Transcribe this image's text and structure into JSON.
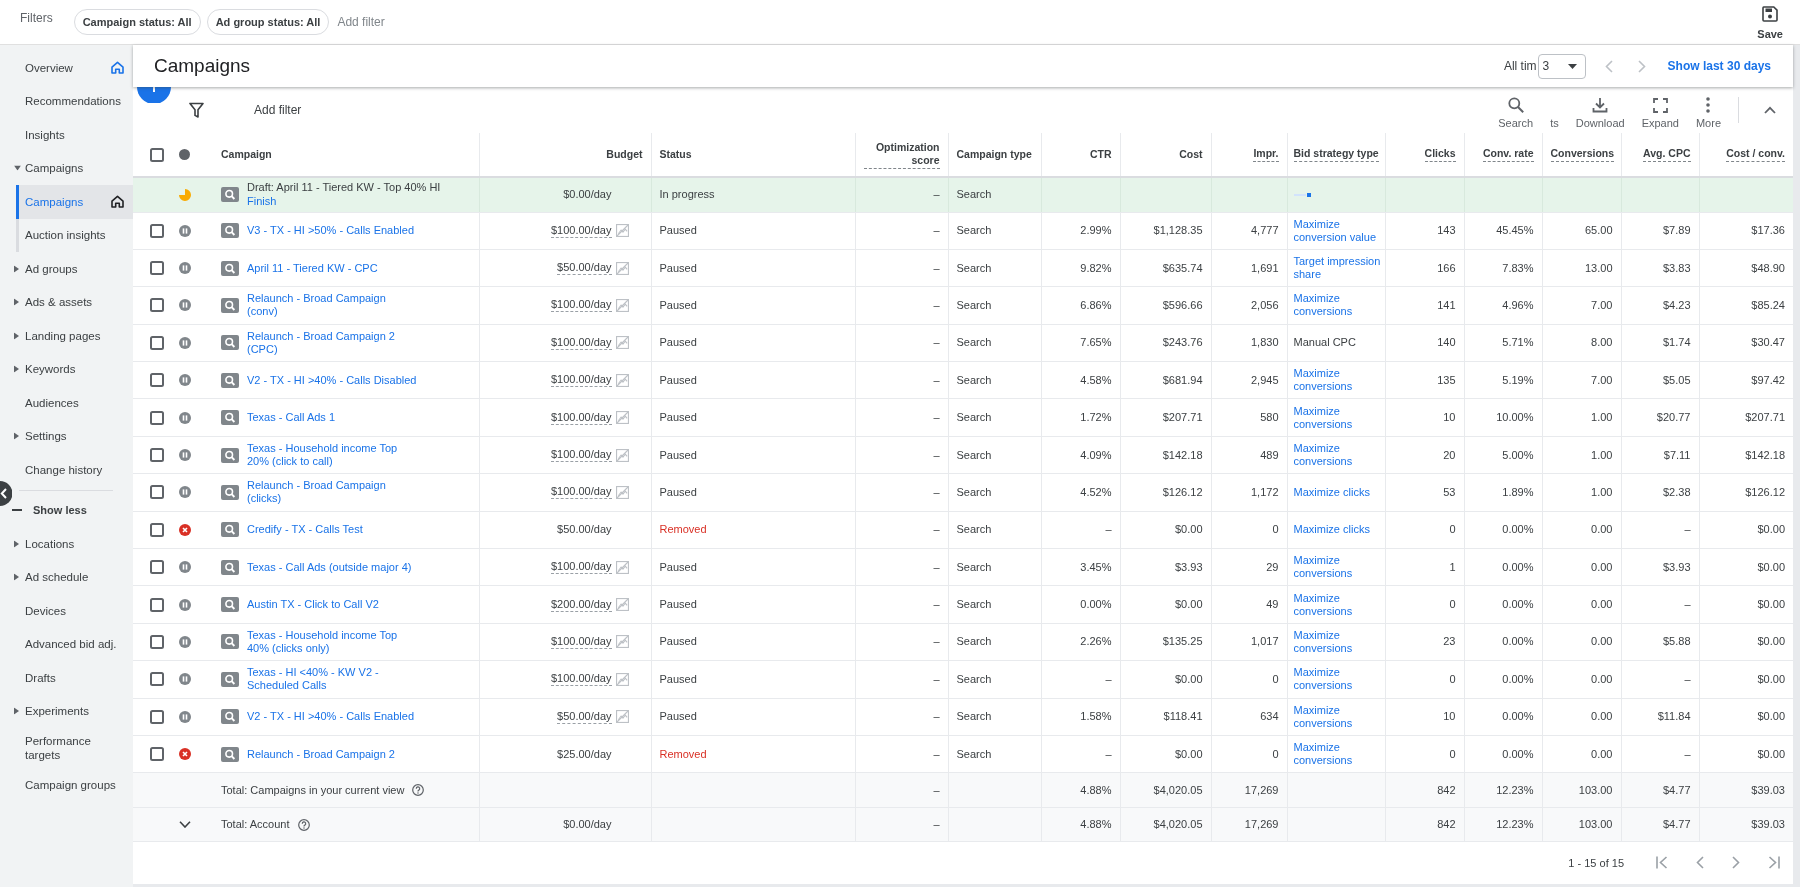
{
  "filter_bar": {
    "label": "Filters",
    "chips": [
      "Campaign status: All",
      "Ad group status: All"
    ],
    "add_filter": "Add filter",
    "save": "Save"
  },
  "sidebar": {
    "items": [
      {
        "label": "Overview",
        "selected": false,
        "home": true
      },
      {
        "label": "Recommendations",
        "selected": false
      },
      {
        "label": "Insights",
        "selected": false
      },
      {
        "label": "Campaigns",
        "selected": false,
        "expanded": true,
        "children": [
          {
            "label": "Campaigns",
            "selected": true,
            "home": false
          },
          {
            "label": "Auction insights",
            "selected": false
          }
        ]
      },
      {
        "label": "Ad groups",
        "selected": false,
        "expanded": false
      },
      {
        "label": "Ads & assets",
        "selected": false,
        "expanded": false
      },
      {
        "label": "Landing pages",
        "selected": false,
        "expanded": false
      },
      {
        "label": "Keywords",
        "selected": false,
        "expanded": false
      },
      {
        "label": "Audiences",
        "selected": false
      },
      {
        "label": "Settings",
        "selected": false,
        "expanded": false
      },
      {
        "label": "Change history",
        "selected": false
      }
    ],
    "toggle": "Show less",
    "more_items": [
      {
        "label": "Locations",
        "selected": false,
        "expanded": false
      },
      {
        "label": "Ad schedule",
        "selected": false,
        "expanded": false
      },
      {
        "label": "Devices",
        "selected": false
      },
      {
        "label": "Advanced bid adj.",
        "selected": false
      },
      {
        "label": "Drafts",
        "selected": false
      },
      {
        "label": "Experiments",
        "selected": false,
        "expanded": false
      },
      {
        "label": "Performance targets",
        "selected": false
      },
      {
        "label": "Campaign groups",
        "selected": false
      }
    ]
  },
  "page_header": {
    "title": "Campaigns",
    "date_label": "All tim",
    "date_value": "3",
    "date_link": "Show last 30 days"
  },
  "toolbar": {
    "add_filter": "Add filter",
    "buttons": [
      {
        "kind": "search",
        "label": "Search"
      },
      {
        "kind": "text",
        "label": "ts"
      },
      {
        "kind": "download",
        "label": "Download"
      },
      {
        "kind": "expand",
        "label": "Expand"
      },
      {
        "kind": "more",
        "label": "More"
      }
    ]
  },
  "table": {
    "select_all": {
      "checked": false
    },
    "columns": [
      {
        "label": "Campaign",
        "kind": "text",
        "dashed": false
      },
      {
        "label": "Budget",
        "kind": "number",
        "dashed": false
      },
      {
        "label": "Status",
        "kind": "text",
        "dashed": false
      },
      {
        "label": "Optimization score",
        "kind": "number",
        "dashed": true
      },
      {
        "label": "Campaign type",
        "kind": "text",
        "dashed": false
      },
      {
        "label": "CTR",
        "kind": "number",
        "dashed": false
      },
      {
        "label": "Cost",
        "kind": "number",
        "dashed": false
      },
      {
        "label": "Impr.",
        "kind": "number",
        "dashed": true
      },
      {
        "label": "Bid strategy type",
        "kind": "text",
        "dashed": true
      },
      {
        "label": "Clicks",
        "kind": "number",
        "dashed": true
      },
      {
        "label": "Conv. rate",
        "kind": "number",
        "dashed": true
      },
      {
        "label": "Conversions",
        "kind": "number",
        "dashed": true
      },
      {
        "label": "Avg. CPC",
        "kind": "number",
        "dashed": true
      },
      {
        "label": "Cost / conv.",
        "kind": "number",
        "dashed": true
      }
    ],
    "rows": [
      {
        "kind": "draft",
        "action": "Finish",
        "budget_icon": false,
        "cells": [
          "Draft: April 11 - Tiered KW - Top 40% HI",
          "$0.00/day",
          "In progress",
          "–",
          "Search",
          "",
          "",
          "",
          "",
          "",
          "",
          "",
          "",
          ""
        ]
      },
      {
        "kind": "paused",
        "checked": false,
        "budget_icon": true,
        "bid_link": true,
        "cells": [
          "V3 - TX - HI >50% - Calls Enabled",
          "$100.00/day",
          "Paused",
          "–",
          "Search",
          "2.99%",
          "$1,128.35",
          "4,777",
          "Maximize conversion value",
          "143",
          "45.45%",
          "65.00",
          "$7.89",
          "$17.36"
        ]
      },
      {
        "kind": "paused",
        "checked": false,
        "budget_icon": true,
        "bid_link": true,
        "cells": [
          "April 11 - Tiered KW - CPC",
          "$50.00/day",
          "Paused",
          "–",
          "Search",
          "9.82%",
          "$635.74",
          "1,691",
          "Target impression share",
          "166",
          "7.83%",
          "13.00",
          "$3.83",
          "$48.90"
        ]
      },
      {
        "kind": "paused",
        "checked": false,
        "budget_icon": true,
        "bid_link": true,
        "cells": [
          "Relaunch - Broad Campaign (conv)",
          "$100.00/day",
          "Paused",
          "–",
          "Search",
          "6.86%",
          "$596.66",
          "2,056",
          "Maximize conversions",
          "141",
          "4.96%",
          "7.00",
          "$4.23",
          "$85.24"
        ]
      },
      {
        "kind": "paused",
        "checked": false,
        "budget_icon": true,
        "bid_link": false,
        "cells": [
          "Relaunch - Broad Campaign 2 (CPC)",
          "$100.00/day",
          "Paused",
          "–",
          "Search",
          "7.65%",
          "$243.76",
          "1,830",
          "Manual CPC",
          "140",
          "5.71%",
          "8.00",
          "$1.74",
          "$30.47"
        ]
      },
      {
        "kind": "paused",
        "checked": false,
        "budget_icon": true,
        "bid_link": true,
        "cells": [
          "V2 - TX - HI >40% - Calls Disabled",
          "$100.00/day",
          "Paused",
          "–",
          "Search",
          "4.58%",
          "$681.94",
          "2,945",
          "Maximize conversions",
          "135",
          "5.19%",
          "7.00",
          "$5.05",
          "$97.42"
        ]
      },
      {
        "kind": "paused",
        "checked": false,
        "budget_icon": true,
        "bid_link": true,
        "cells": [
          "Texas - Call Ads 1",
          "$100.00/day",
          "Paused",
          "–",
          "Search",
          "1.72%",
          "$207.71",
          "580",
          "Maximize conversions",
          "10",
          "10.00%",
          "1.00",
          "$20.77",
          "$207.71"
        ]
      },
      {
        "kind": "paused",
        "checked": false,
        "budget_icon": true,
        "bid_link": true,
        "cells": [
          "Texas - Household income Top 20% (click to call)",
          "$100.00/day",
          "Paused",
          "–",
          "Search",
          "4.09%",
          "$142.18",
          "489",
          "Maximize conversions",
          "20",
          "5.00%",
          "1.00",
          "$7.11",
          "$142.18"
        ]
      },
      {
        "kind": "paused",
        "checked": false,
        "budget_icon": true,
        "bid_link": true,
        "cells": [
          "Relaunch - Broad Campaign (clicks)",
          "$100.00/day",
          "Paused",
          "–",
          "Search",
          "4.52%",
          "$126.12",
          "1,172",
          "Maximize clicks",
          "53",
          "1.89%",
          "1.00",
          "$2.38",
          "$126.12"
        ]
      },
      {
        "kind": "removed",
        "checked": false,
        "budget_icon": false,
        "bid_link": true,
        "cells": [
          "Credify - TX - Calls Test",
          "$50.00/day",
          "Removed",
          "–",
          "Search",
          "–",
          "$0.00",
          "0",
          "Maximize clicks",
          "0",
          "0.00%",
          "0.00",
          "–",
          "$0.00"
        ]
      },
      {
        "kind": "paused",
        "checked": false,
        "budget_icon": true,
        "bid_link": true,
        "cells": [
          "Texas - Call Ads (outside major 4)",
          "$100.00/day",
          "Paused",
          "–",
          "Search",
          "3.45%",
          "$3.93",
          "29",
          "Maximize conversions",
          "1",
          "0.00%",
          "0.00",
          "$3.93",
          "$0.00"
        ]
      },
      {
        "kind": "paused",
        "checked": false,
        "budget_icon": true,
        "bid_link": true,
        "cells": [
          "Austin TX - Click to Call V2",
          "$200.00/day",
          "Paused",
          "–",
          "Search",
          "0.00%",
          "$0.00",
          "49",
          "Maximize conversions",
          "0",
          "0.00%",
          "0.00",
          "–",
          "$0.00"
        ]
      },
      {
        "kind": "paused",
        "checked": false,
        "budget_icon": true,
        "bid_link": true,
        "cells": [
          "Texas - Household income Top 40% (clicks only)",
          "$100.00/day",
          "Paused",
          "–",
          "Search",
          "2.26%",
          "$135.25",
          "1,017",
          "Maximize conversions",
          "23",
          "0.00%",
          "0.00",
          "$5.88",
          "$0.00"
        ]
      },
      {
        "kind": "paused",
        "checked": false,
        "budget_icon": true,
        "bid_link": true,
        "cells": [
          "Texas - HI <40% - KW V2 - Scheduled Calls",
          "$100.00/day",
          "Paused",
          "–",
          "Search",
          "–",
          "$0.00",
          "0",
          "Maximize conversions",
          "0",
          "0.00%",
          "0.00",
          "–",
          "$0.00"
        ]
      },
      {
        "kind": "paused",
        "checked": false,
        "budget_icon": true,
        "bid_link": true,
        "cells": [
          "V2 - TX - HI >40% - Calls Enabled",
          "$50.00/day",
          "Paused",
          "–",
          "Search",
          "1.58%",
          "$118.41",
          "634",
          "Maximize conversions",
          "10",
          "0.00%",
          "0.00",
          "$11.84",
          "$0.00"
        ]
      },
      {
        "kind": "removed",
        "checked": false,
        "budget_icon": false,
        "bid_link": true,
        "cells": [
          "Relaunch - Broad Campaign 2",
          "$25.00/day",
          "Removed",
          "–",
          "Search",
          "–",
          "$0.00",
          "0",
          "Maximize conversions",
          "0",
          "0.00%",
          "0.00",
          "–",
          "$0.00"
        ]
      }
    ],
    "totals": [
      {
        "cells": [
          "Total: Campaigns in your current view",
          "",
          "",
          "–",
          "",
          "4.88%",
          "$4,020.05",
          "17,269",
          "",
          "842",
          "12.23%",
          "103.00",
          "$4.77",
          "$39.03"
        ]
      },
      {
        "expanded": false,
        "cells": [
          "Total: Account",
          "$0.00/day",
          "",
          "–",
          "",
          "4.88%",
          "$4,020.05",
          "17,269",
          "",
          "842",
          "12.23%",
          "103.00",
          "$4.77",
          "$39.03"
        ]
      }
    ]
  },
  "pagination": {
    "range": "1 - 15 of 15"
  }
}
